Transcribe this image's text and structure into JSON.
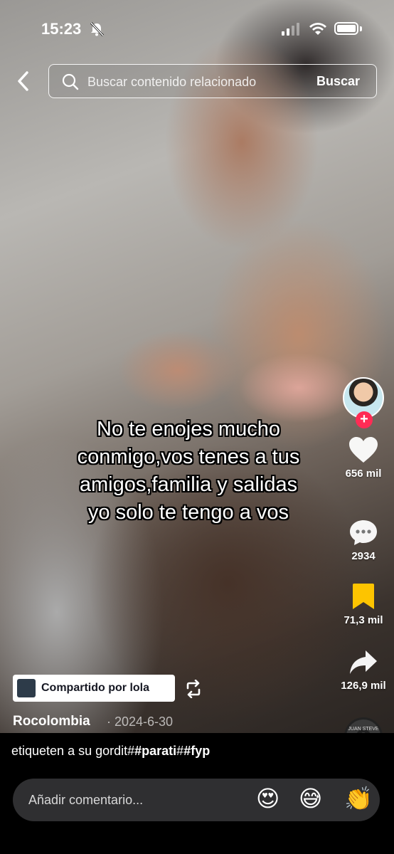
{
  "status": {
    "time": "15:23"
  },
  "search": {
    "placeholder": "Buscar contenido relacionado",
    "button_label": "Buscar"
  },
  "video": {
    "overlay_lines": [
      "No te enojes mucho",
      "conmigo,vos tenes a tus",
      "amigos,familia y salidas",
      "yo solo te tengo a vos"
    ]
  },
  "actions": {
    "likes": "656 mil",
    "comments": "2934",
    "saves": "71,3 mil",
    "shares": "126,9 mil",
    "follow_symbol": "+"
  },
  "music": {
    "disc_label": "JUAN STEVE"
  },
  "shared_by": {
    "label": "Compartido por lola"
  },
  "post": {
    "author": "Rocolombia",
    "date": "· 2024-6-30",
    "caption_prefix": "etiqueten a su gordit#",
    "caption_tag1": "#parati",
    "caption_sep": "#",
    "caption_tag2": "#fyp"
  },
  "comment_bar": {
    "placeholder": "Añadir comentario...",
    "emojis": [
      "😍",
      "😅",
      "👏"
    ]
  },
  "colors": {
    "accent": "#fe2c55",
    "save": "#fdc400",
    "background": "#000000"
  }
}
